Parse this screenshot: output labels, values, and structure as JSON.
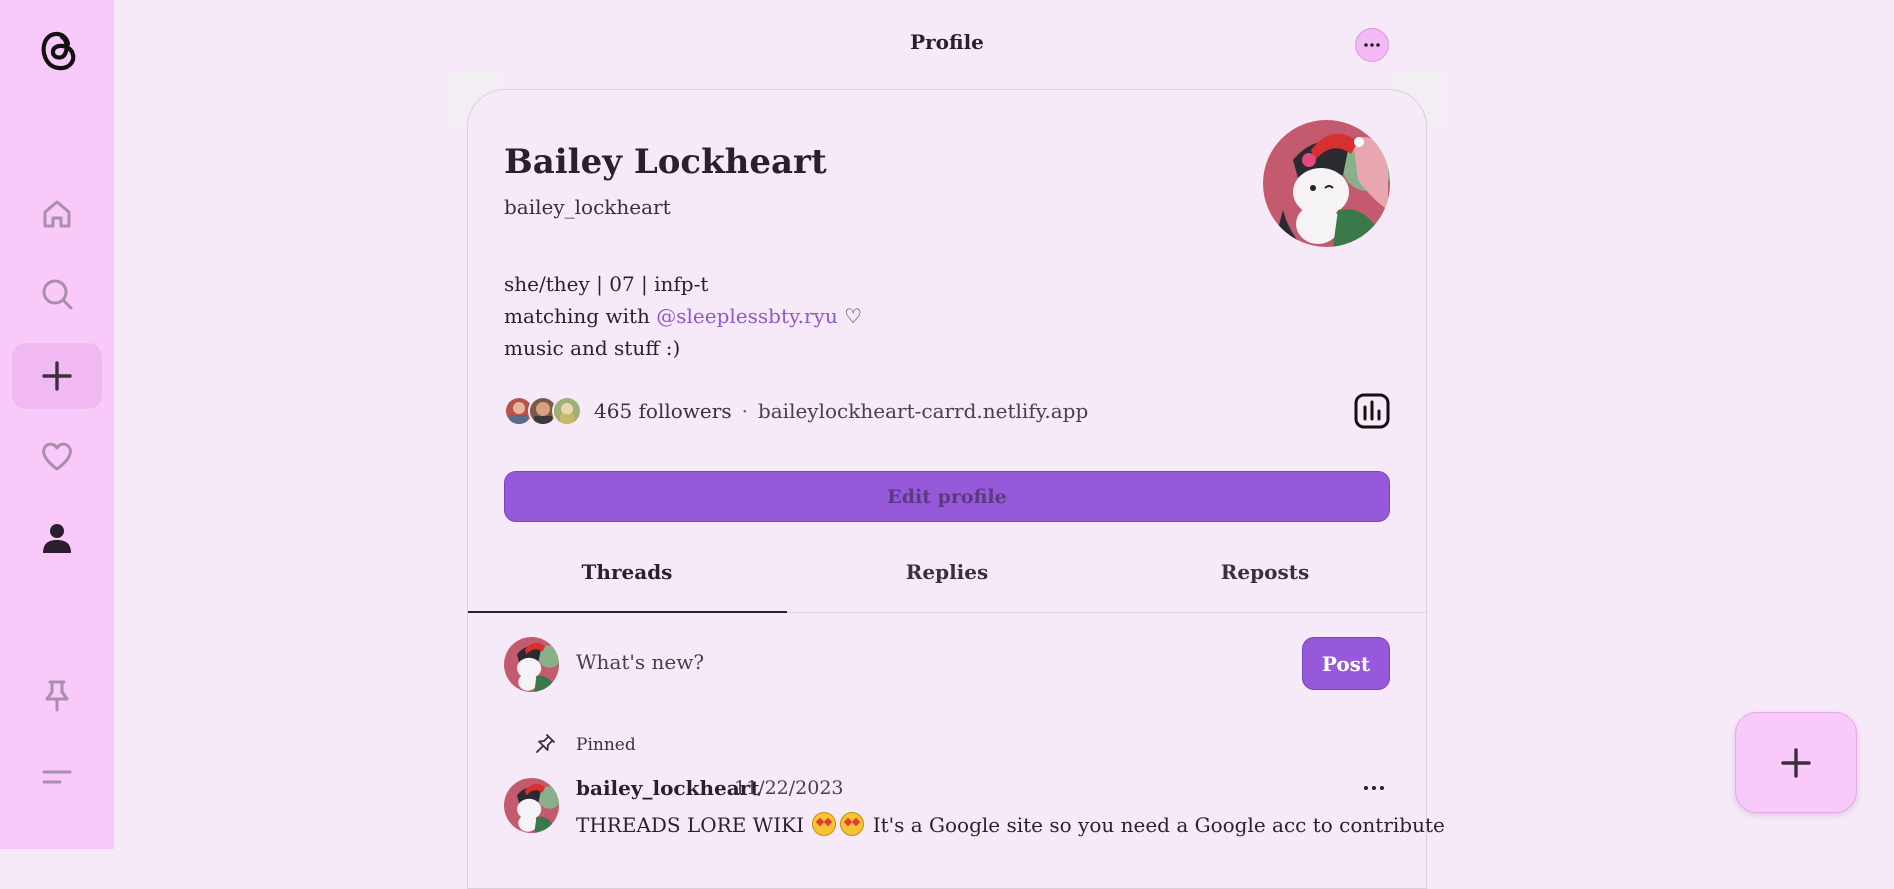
{
  "sidebar": {
    "logo_icon": "threads-logo-icon",
    "items": [
      {
        "name": "home",
        "icon": "home-icon"
      },
      {
        "name": "search",
        "icon": "search-icon"
      },
      {
        "name": "create",
        "icon": "plus-icon"
      },
      {
        "name": "activity",
        "icon": "heart-icon"
      },
      {
        "name": "profile",
        "icon": "person-icon"
      },
      {
        "name": "pin",
        "icon": "pin-icon"
      },
      {
        "name": "menu",
        "icon": "menu-icon"
      }
    ]
  },
  "header": {
    "title": "Profile",
    "more_icon": "ellipsis-icon"
  },
  "profile": {
    "name": "Bailey Lockheart",
    "handle": "bailey_lockheart",
    "bio_line1": "she/they | 07 | infp-t",
    "bio_line2_prefix": "matching with ",
    "bio_line2_mention": "@sleeplessbty.ryu",
    "bio_line2_suffix": " ♡",
    "bio_line3": "music and stuff :)",
    "followers": "465 followers",
    "separator": "·",
    "link": "baileylockheart-carrd.netlify.app",
    "edit_label": "Edit profile"
  },
  "tabs": [
    {
      "label": "Threads",
      "active": true
    },
    {
      "label": "Replies",
      "active": false
    },
    {
      "label": "Reposts",
      "active": false
    }
  ],
  "composer": {
    "placeholder": "What's new?",
    "post_label": "Post"
  },
  "pinned_post": {
    "pinned_label": "Pinned",
    "username": "bailey_lockheart",
    "date": "11/22/2023",
    "text_before": "THREADS LORE WIKI",
    "text_after": "It's a Google site so you need a Google acc to contribute"
  },
  "colors": {
    "accent": "#9559d9",
    "sidebar": "#f9c9f9",
    "background": "#f6e9f8",
    "mention": "#8d5ac6"
  }
}
